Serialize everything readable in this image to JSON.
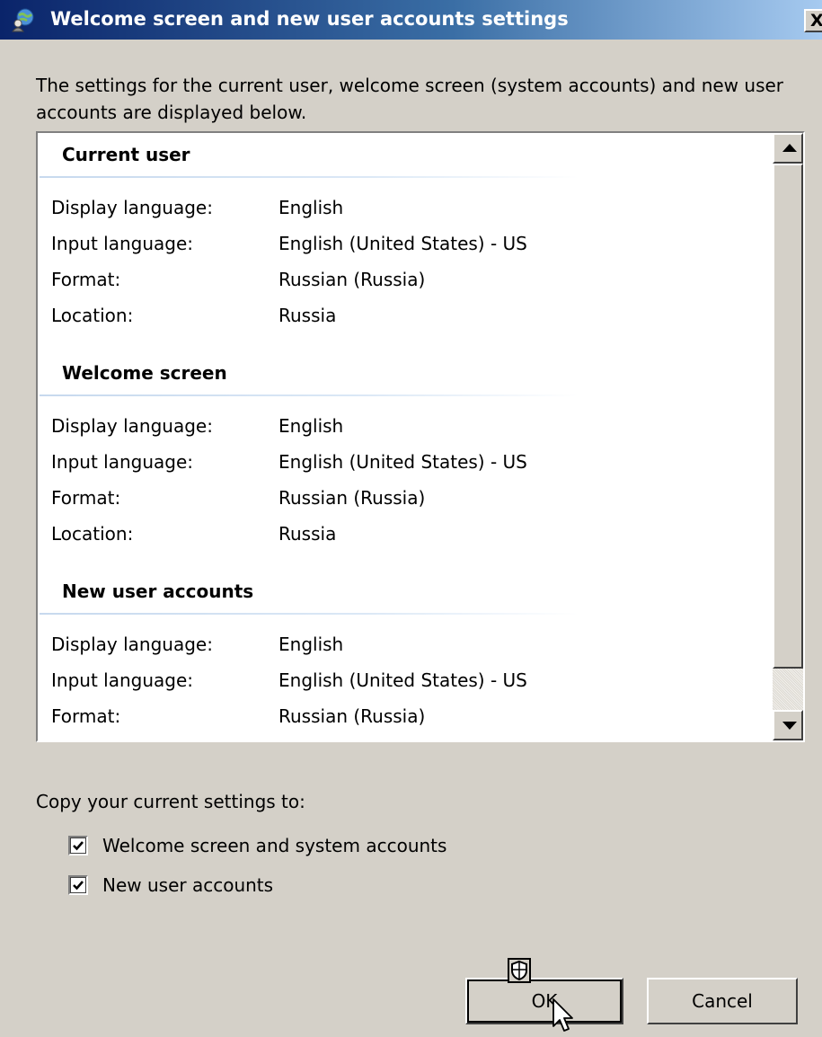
{
  "window": {
    "title": "Welcome screen and new user accounts settings",
    "close_glyph": "X"
  },
  "intro_text": "The settings for the current user, welcome screen (system accounts) and new user accounts are displayed below.",
  "sections": [
    {
      "title": "Current user",
      "rows": [
        {
          "label": "Display language:",
          "value": "English"
        },
        {
          "label": "Input language:",
          "value": "English (United States) - US"
        },
        {
          "label": "Format:",
          "value": "Russian (Russia)"
        },
        {
          "label": "Location:",
          "value": "Russia"
        }
      ]
    },
    {
      "title": "Welcome screen",
      "rows": [
        {
          "label": "Display language:",
          "value": "English"
        },
        {
          "label": "Input language:",
          "value": "English (United States) - US"
        },
        {
          "label": "Format:",
          "value": "Russian (Russia)"
        },
        {
          "label": "Location:",
          "value": "Russia"
        }
      ]
    },
    {
      "title": "New user accounts",
      "rows": [
        {
          "label": "Display language:",
          "value": "English"
        },
        {
          "label": "Input language:",
          "value": "English (United States) - US"
        },
        {
          "label": "Format:",
          "value": "Russian (Russia)"
        }
      ]
    }
  ],
  "copy_settings": {
    "label": "Copy your current settings to:",
    "options": [
      {
        "label": "Welcome screen and system accounts",
        "checked": true
      },
      {
        "label": "New user accounts",
        "checked": true
      }
    ]
  },
  "buttons": {
    "ok": "OK",
    "cancel": "Cancel"
  },
  "icons": {
    "title": "globe-user-icon",
    "ok_badge": "uac-shield-icon",
    "cursor": "mouse-pointer-icon"
  },
  "colors": {
    "title_bar_start": "#0a246a",
    "title_bar_end": "#a6caf0",
    "dialog_bg": "#d4d0c8",
    "section_rule": "#c7d9ee"
  }
}
